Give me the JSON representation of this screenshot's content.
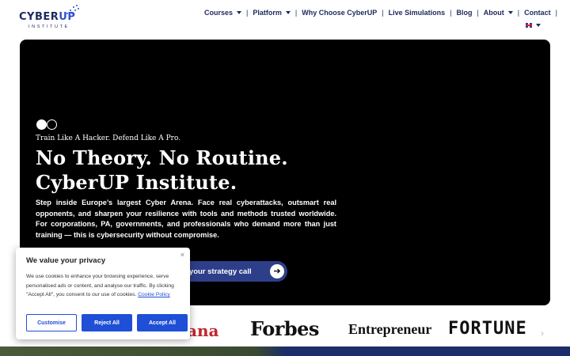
{
  "header": {
    "logo": {
      "name": "CYBERUP",
      "sub": "INSTITUTE"
    },
    "nav": [
      {
        "label": "Courses",
        "has_dropdown": true
      },
      {
        "label": "Platform",
        "has_dropdown": true
      },
      {
        "label": "Why Choose CyberUP",
        "has_dropdown": false
      },
      {
        "label": "Live Simulations",
        "has_dropdown": false
      },
      {
        "label": "Blog",
        "has_dropdown": false
      },
      {
        "label": "About",
        "has_dropdown": true
      },
      {
        "label": "Contact",
        "has_dropdown": false
      }
    ],
    "language_icon": "uk-flag-icon"
  },
  "hero": {
    "tagline": "Train Like A Hacker. Defend Like A Pro.",
    "headline_line1": "No Theory. No Routine.",
    "headline_line2": "CyberUP Institute.",
    "description": "Step inside Europe’s largest Cyber Arena. Face real cyberattacks, outsmart real opponents, and sharpen your resilience with tools and methods trusted worldwide. For corporations, PA, governments, and professionals who demand more than just training — this is cybersecurity without compromise.",
    "cta_label": "Book your strategy call",
    "cta_visible_label": "k your strategy call"
  },
  "press_logos": [
    "ana",
    "Forbes",
    "Entrepreneur",
    "FORTUNE"
  ],
  "cookie": {
    "title": "We value your privacy",
    "body": "We use cookies to enhance your browsing experience, serve personalised ads or content, and analyse our traffic. By clicking \"Accept All\", you consent to our use of cookies.",
    "policy_link": "Cookie Policy",
    "customise": "Customise",
    "reject": "Reject All",
    "accept": "Accept All",
    "close": "×"
  },
  "colors": {
    "brand_navy": "#1d2a5c",
    "accent_blue": "#1f4fd6",
    "hero_bg": "#000000"
  }
}
